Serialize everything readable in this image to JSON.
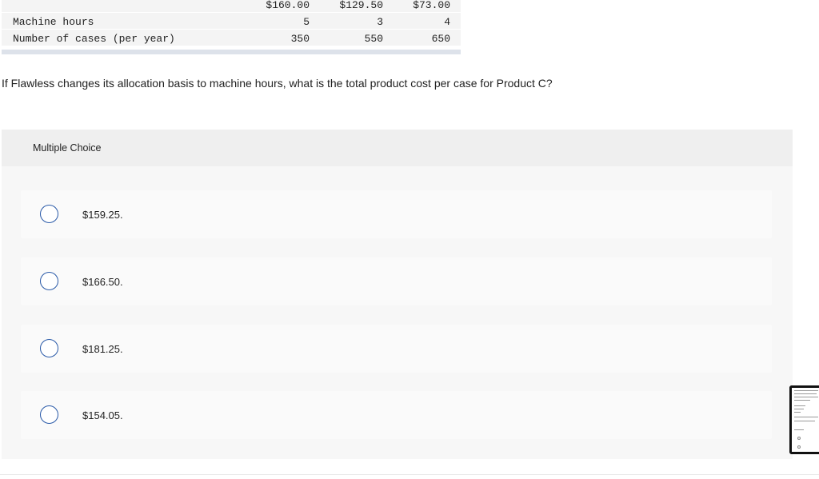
{
  "table": {
    "rows": [
      {
        "label": "",
        "values": [
          "$160.00",
          "$129.50",
          "$73.00"
        ]
      },
      {
        "label": "Machine hours",
        "values": [
          "5",
          "3",
          "4"
        ]
      },
      {
        "label": "Number of cases (per year)",
        "values": [
          "350",
          "550",
          "650"
        ]
      }
    ]
  },
  "question": "If Flawless changes its allocation basis to machine hours, what is the total product cost per case for Product C?",
  "multiple_choice": {
    "title": "Multiple Choice",
    "options": [
      {
        "label": "$159.25."
      },
      {
        "label": "$166.50."
      },
      {
        "label": "$181.25."
      },
      {
        "label": "$154.05."
      }
    ]
  },
  "colors": {
    "accent": "#2a5aa8",
    "panel": "#f7f7f7",
    "header": "#efefef"
  }
}
